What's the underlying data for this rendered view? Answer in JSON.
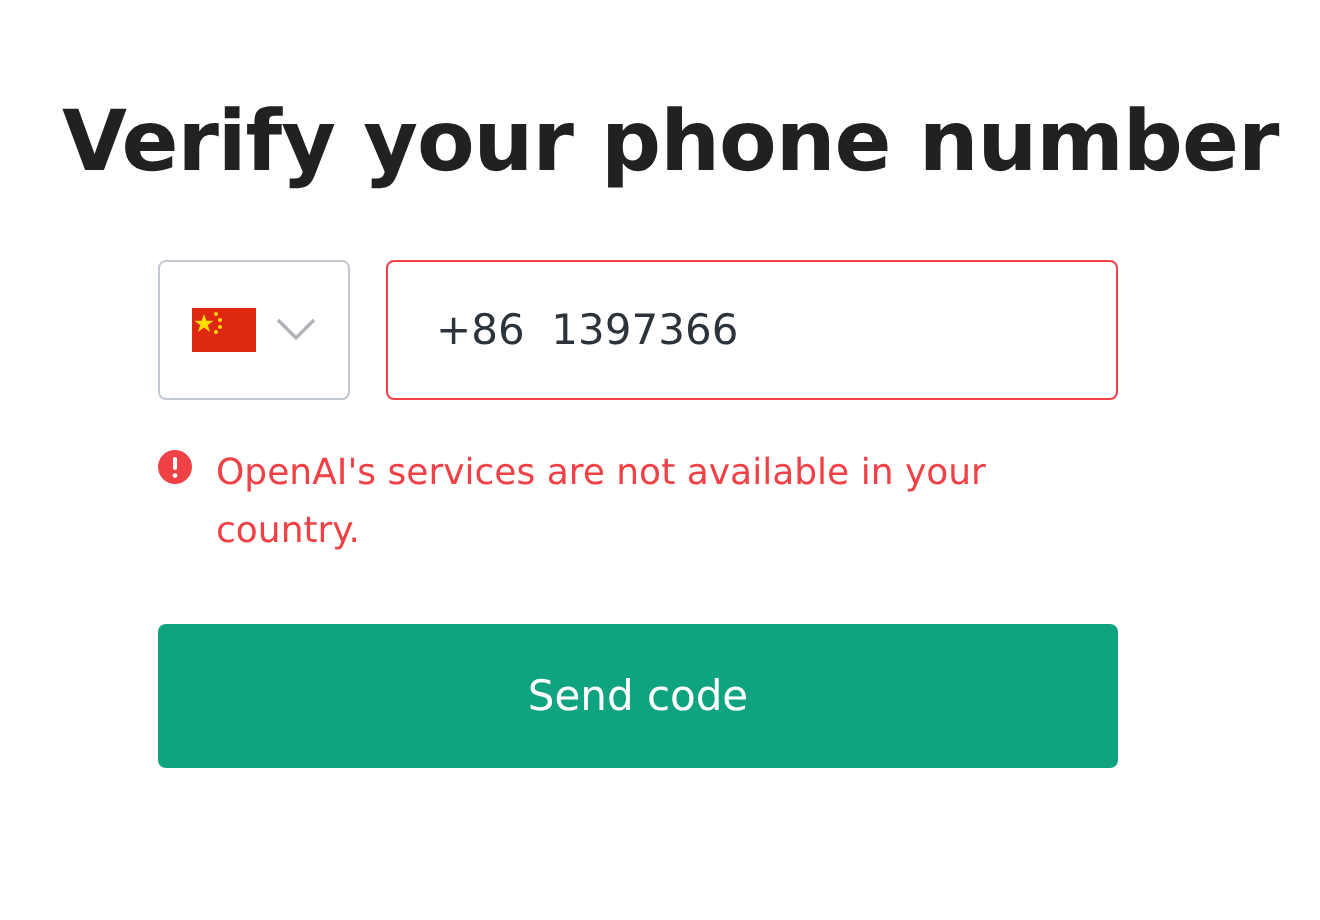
{
  "title": "Verify your phone number",
  "phone": {
    "value": "+86  1397366",
    "error": true
  },
  "error_message": "OpenAI's services are not available in your country.",
  "button": "Send code"
}
